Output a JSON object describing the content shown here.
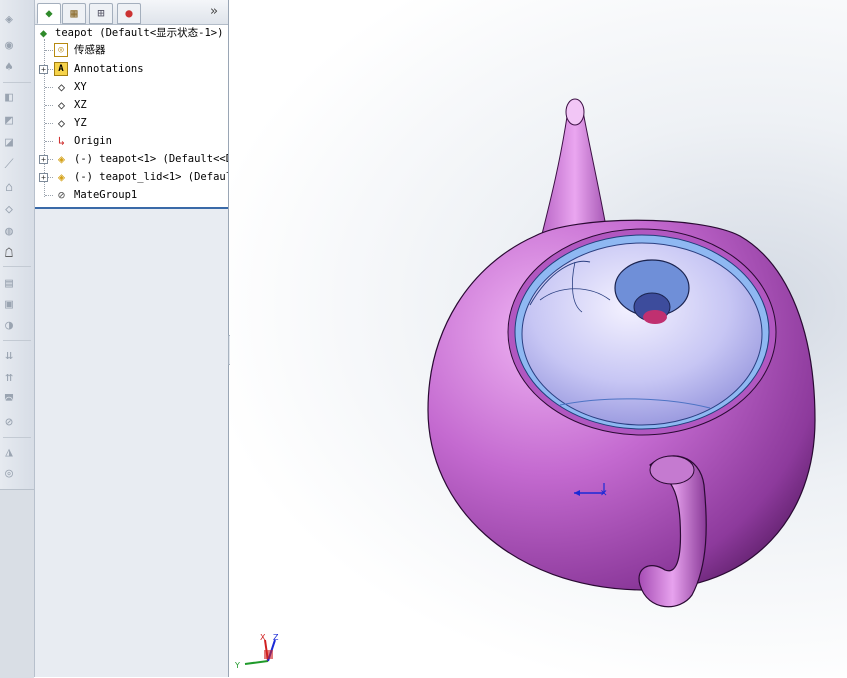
{
  "tabs": [
    {
      "name": "feature-manager-tab",
      "icon": "feature-manager-icon"
    },
    {
      "name": "property-manager-tab",
      "icon": "property-manager-icon"
    },
    {
      "name": "configuration-manager-tab",
      "icon": "configuration-manager-icon"
    },
    {
      "name": "display-manager-tab",
      "icon": "display-manager-icon"
    }
  ],
  "tab_more": "»",
  "tree": {
    "root_label": "teapot  (Default<显示状态-1>)",
    "items": [
      {
        "label": "传感器",
        "icon": "sensor-icon"
      },
      {
        "label": "Annotations",
        "icon": "annotations-icon",
        "expandable": true
      },
      {
        "label": "XY",
        "icon": "plane-icon"
      },
      {
        "label": "XZ",
        "icon": "plane-icon"
      },
      {
        "label": "YZ",
        "icon": "plane-icon"
      },
      {
        "label": "Origin",
        "icon": "origin-icon"
      },
      {
        "label": "(-) teapot<1> (Default<<De",
        "icon": "part-icon",
        "expandable": true
      },
      {
        "label": "(-) teapot_lid<1> (Defaul",
        "icon": "part-icon",
        "expandable": true
      },
      {
        "label": "MateGroup1",
        "icon": "mate-group-icon"
      }
    ]
  },
  "triad": {
    "x": "X",
    "y": "Y",
    "z": "Z"
  },
  "colors": {
    "teapot_body": "#c46ad0",
    "teapot_interior": "#8fb8f2",
    "panel_bg": "#e8ecf2",
    "tree_separator": "#3a6aa8"
  }
}
